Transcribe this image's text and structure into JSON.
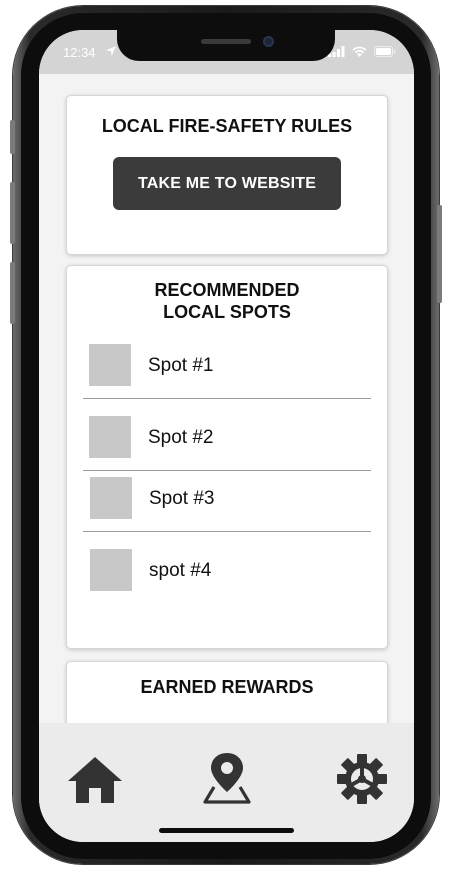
{
  "status_bar": {
    "time": "12:34",
    "icons": [
      "location-arrow-icon",
      "signal-icon",
      "wifi-icon",
      "battery-icon"
    ]
  },
  "fire_safety_card": {
    "title": "LOCAL FIRE-SAFETY RULES",
    "button_label": "TAKE ME TO WEBSITE"
  },
  "spots_card": {
    "title_line1": "RECOMMENDED",
    "title_line2": "LOCAL SPOTS",
    "items": [
      {
        "label": "Spot #1"
      },
      {
        "label": "Spot #2"
      },
      {
        "label": "Spot #3"
      },
      {
        "label": "spot #4"
      }
    ]
  },
  "rewards_card": {
    "title": "EARNED REWARDS"
  },
  "tab_bar": {
    "tabs": [
      "home-icon",
      "map-pin-icon",
      "settings-gear-icon"
    ]
  },
  "colors": {
    "button_bg": "#3b3b3b",
    "icon": "#333333",
    "thumbnail": "#c8c8c8",
    "status_bar": "#d4d4d4",
    "tab_bar": "#ebebeb"
  }
}
